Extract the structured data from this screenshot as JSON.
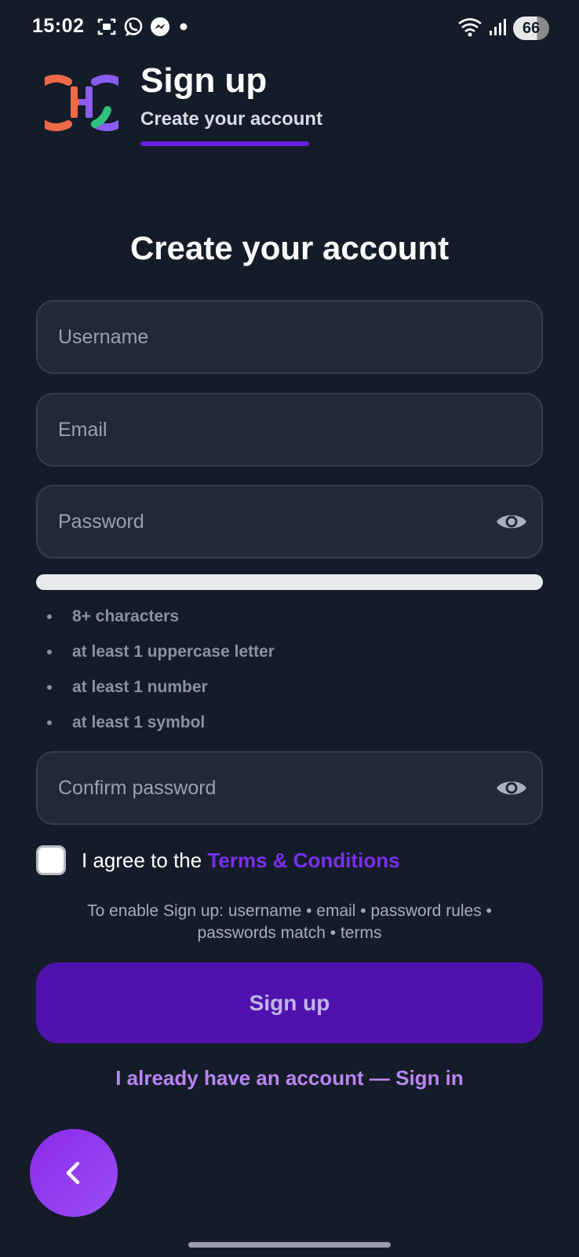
{
  "status_bar": {
    "time": "15:02",
    "battery": "66",
    "left_icons": [
      "screenshot-icon",
      "whatsapp-icon",
      "messenger-icon",
      "dot-icon"
    ],
    "right_icons": [
      "wifi-icon",
      "signal-icon",
      "battery-icon"
    ]
  },
  "header": {
    "title": "Sign up",
    "subtitle": "Create your account"
  },
  "form": {
    "title": "Create your account",
    "username_placeholder": "Username",
    "email_placeholder": "Email",
    "password_placeholder": "Password",
    "confirm_placeholder": "Confirm password",
    "password_strength": 0,
    "rules": [
      "8+ characters",
      "at least 1 uppercase letter",
      "at least 1 number",
      "at least 1 symbol"
    ],
    "terms_prefix": "I agree to the ",
    "terms_link": "Terms & Conditions",
    "terms_checked": false,
    "hint": "To enable Sign up: username • email • password rules • passwords match • terms",
    "signup_label": "Sign up",
    "signin_link": "I already have an account — Sign in"
  },
  "colors": {
    "background": "#151c29",
    "field_bg": "#212838",
    "accent": "#6a1ee0",
    "button_bg": "#4f12ad",
    "link": "#b985f3",
    "fab": "#9140f0"
  }
}
